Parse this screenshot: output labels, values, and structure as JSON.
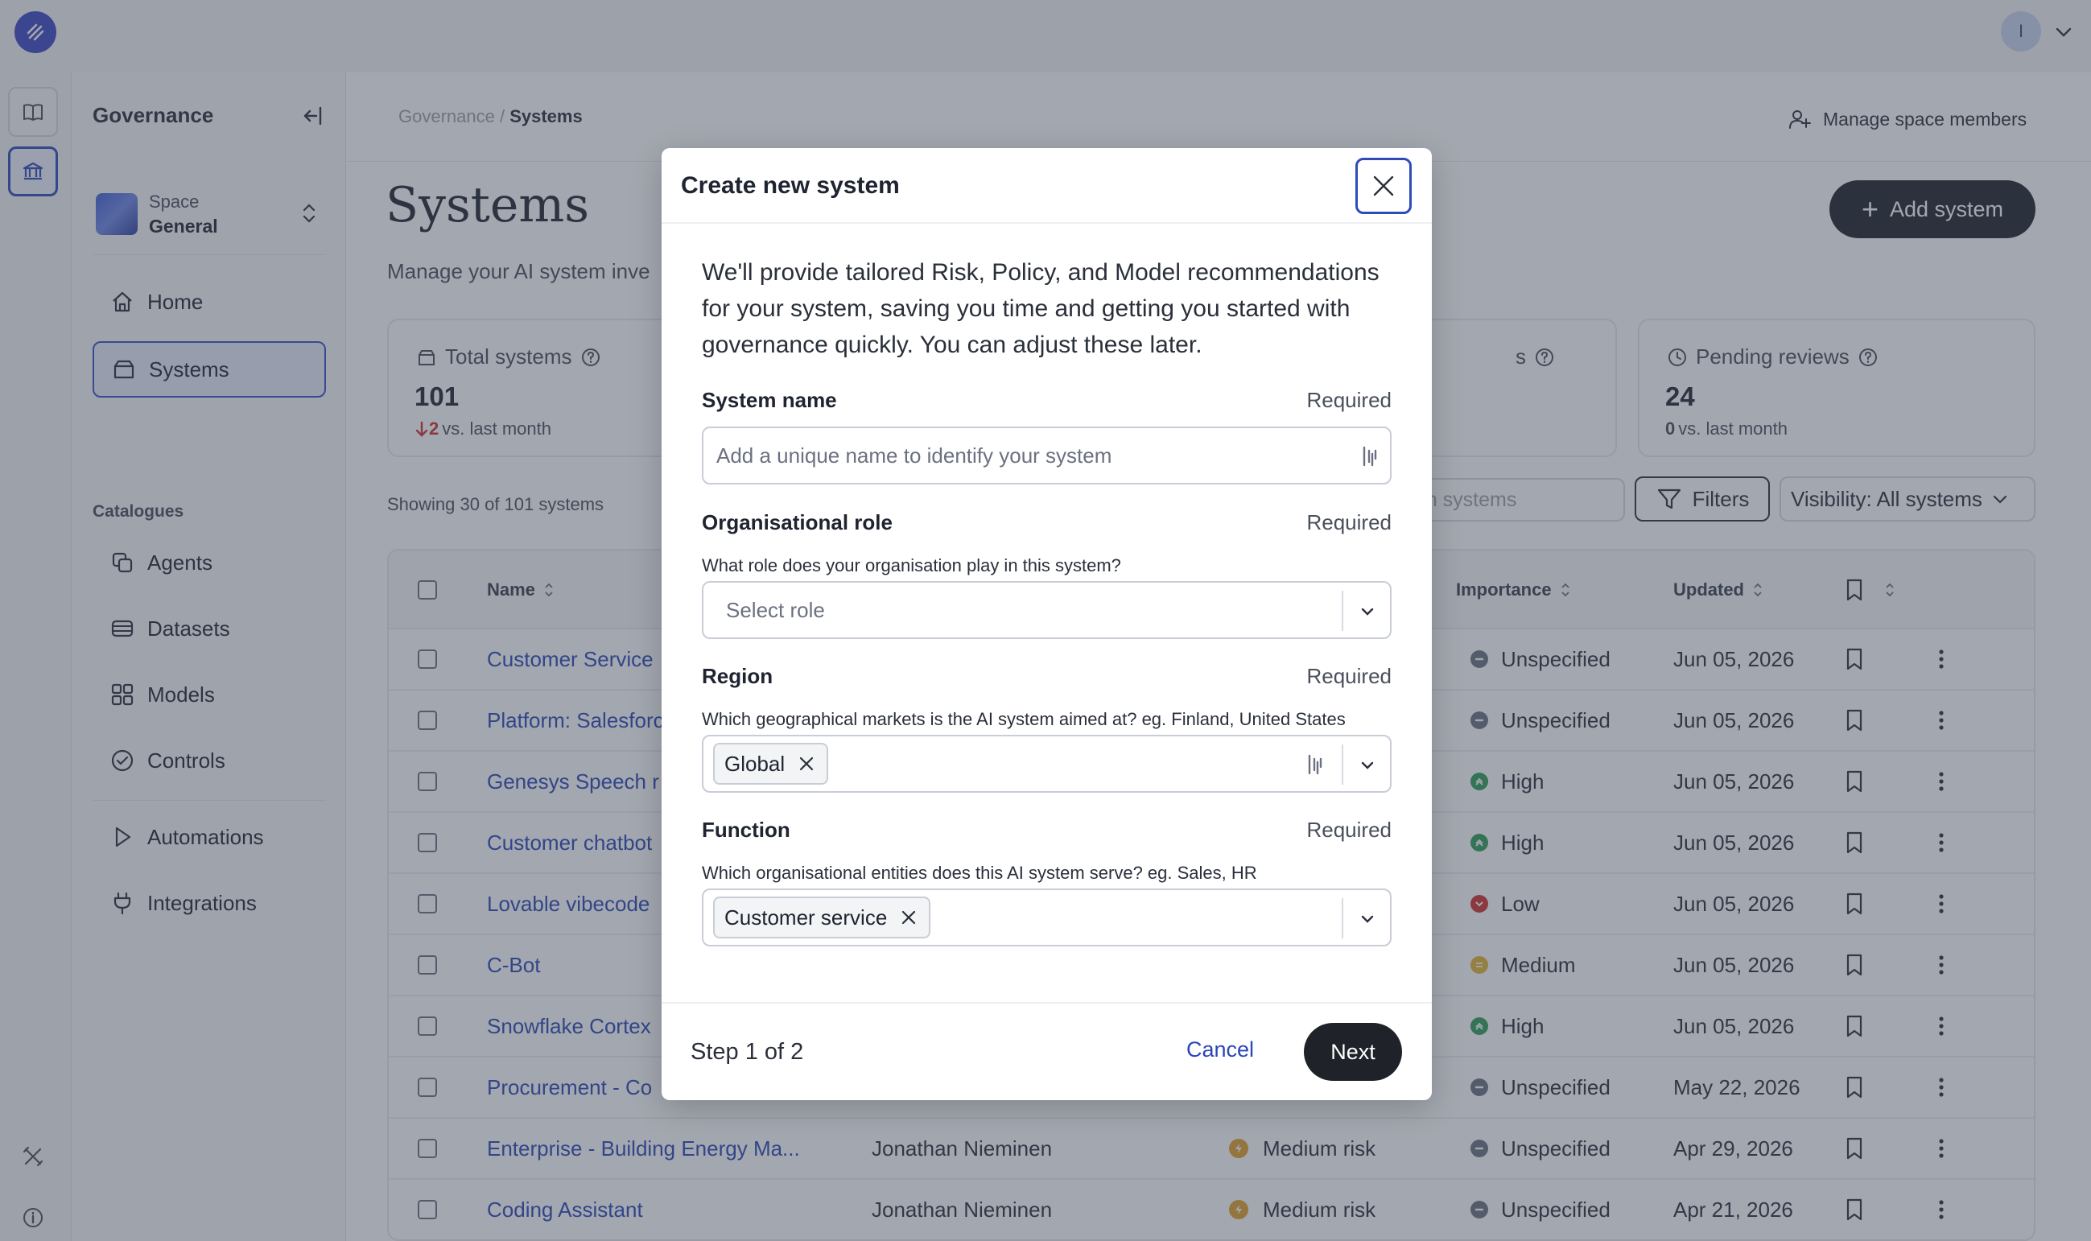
{
  "topbar": {
    "user_initial": "I"
  },
  "sidebar": {
    "title": "Governance",
    "space": {
      "label": "Space",
      "name": "General"
    },
    "nav_main": [
      {
        "label": "Home",
        "icon": "home-icon"
      },
      {
        "label": "Systems",
        "icon": "box-icon",
        "active": true
      }
    ],
    "catalogues_label": "Catalogues",
    "catalogues": [
      {
        "label": "Agents",
        "icon": "agents-icon"
      },
      {
        "label": "Datasets",
        "icon": "datasets-icon"
      },
      {
        "label": "Models",
        "icon": "models-icon"
      },
      {
        "label": "Controls",
        "icon": "check-circle-icon"
      }
    ],
    "other": [
      {
        "label": "Automations",
        "icon": "play-icon"
      },
      {
        "label": "Integrations",
        "icon": "plug-icon"
      }
    ]
  },
  "main": {
    "breadcrumb": {
      "parent": "Governance",
      "separator": " / ",
      "current": "Systems"
    },
    "manage_members": "Manage space members",
    "title": "Systems",
    "add_button": "Add system",
    "subtitle": "Manage your AI system inve",
    "stats": [
      {
        "label": "Total systems",
        "value": "101",
        "delta": "2",
        "delta_suffix": "vs. last month",
        "trend": "down"
      },
      {
        "label": "s",
        "value": "",
        "delta": "",
        "delta_suffix": ""
      },
      {
        "label": "Pending reviews",
        "value": "24",
        "delta": "0",
        "delta_suffix": "vs. last month"
      }
    ],
    "showing": "Showing 30 of 101 systems",
    "search_placeholder": "rch systems",
    "filters_label": "Filters",
    "visibility_label": "Visibility: All systems",
    "table": {
      "headers": {
        "name": "Name",
        "importance": "Importance",
        "updated": "Updated"
      },
      "rows": [
        {
          "name": "Customer Service",
          "owner": "",
          "risk": "",
          "importance": "Unspecified",
          "updated": "Jun 05, 2026"
        },
        {
          "name": "Platform: Salesforc",
          "owner": "",
          "risk": "",
          "importance": "Unspecified",
          "updated": "Jun 05, 2026"
        },
        {
          "name": "Genesys Speech r",
          "owner": "",
          "risk": "",
          "importance": "High",
          "updated": "Jun 05, 2026"
        },
        {
          "name": "Customer chatbot",
          "owner": "",
          "risk": "",
          "importance": "High",
          "updated": "Jun 05, 2026"
        },
        {
          "name": "Lovable vibecode",
          "owner": "",
          "risk": "",
          "importance": "Low",
          "updated": "Jun 05, 2026"
        },
        {
          "name": "C-Bot",
          "owner": "",
          "risk": "",
          "importance": "Medium",
          "updated": "Jun 05, 2026"
        },
        {
          "name": "Snowflake Cortex",
          "owner": "",
          "risk": "",
          "importance": "High",
          "updated": "Jun 05, 2026"
        },
        {
          "name": "Procurement - Co",
          "owner": "",
          "risk": "",
          "importance": "Unspecified",
          "updated": "May 22, 2026"
        },
        {
          "name": "Enterprise - Building Energy Ma...",
          "owner": "Jonathan Nieminen",
          "risk": "Medium risk",
          "importance": "Unspecified",
          "updated": "Apr 29, 2026"
        },
        {
          "name": "Coding Assistant",
          "owner": "Jonathan Nieminen",
          "risk": "Medium risk",
          "importance": "Unspecified",
          "updated": "Apr 21, 2026"
        }
      ]
    }
  },
  "colors": {
    "importance_unspecified": "#6b7180",
    "importance_high": "#2f9e55",
    "importance_low": "#d0312d",
    "importance_medium": "#e2b531",
    "risk_medium": "#e2a12a",
    "link": "#2b46b6",
    "accent": "#2f4bb8"
  },
  "modal": {
    "title": "Create new system",
    "intro": "We'll provide tailored Risk, Policy, and Model recommendations for your system, saving you time and getting you started with governance quickly. You can adjust these later.",
    "system_name": {
      "label": "System name",
      "required": "Required",
      "placeholder": "Add a unique name to identify your system"
    },
    "org_role": {
      "label": "Organisational role",
      "required": "Required",
      "help": "What role does your organisation play in this system?",
      "placeholder": "Select role"
    },
    "region": {
      "label": "Region",
      "required": "Required",
      "help": "Which geographical markets is the AI system aimed at? eg. Finland, United States",
      "chip": "Global"
    },
    "function": {
      "label": "Function",
      "required": "Required",
      "help": "Which organisational entities does this AI system serve? eg. Sales, HR",
      "chip": "Customer service"
    },
    "step": "Step 1 of 2",
    "cancel": "Cancel",
    "next": "Next"
  }
}
